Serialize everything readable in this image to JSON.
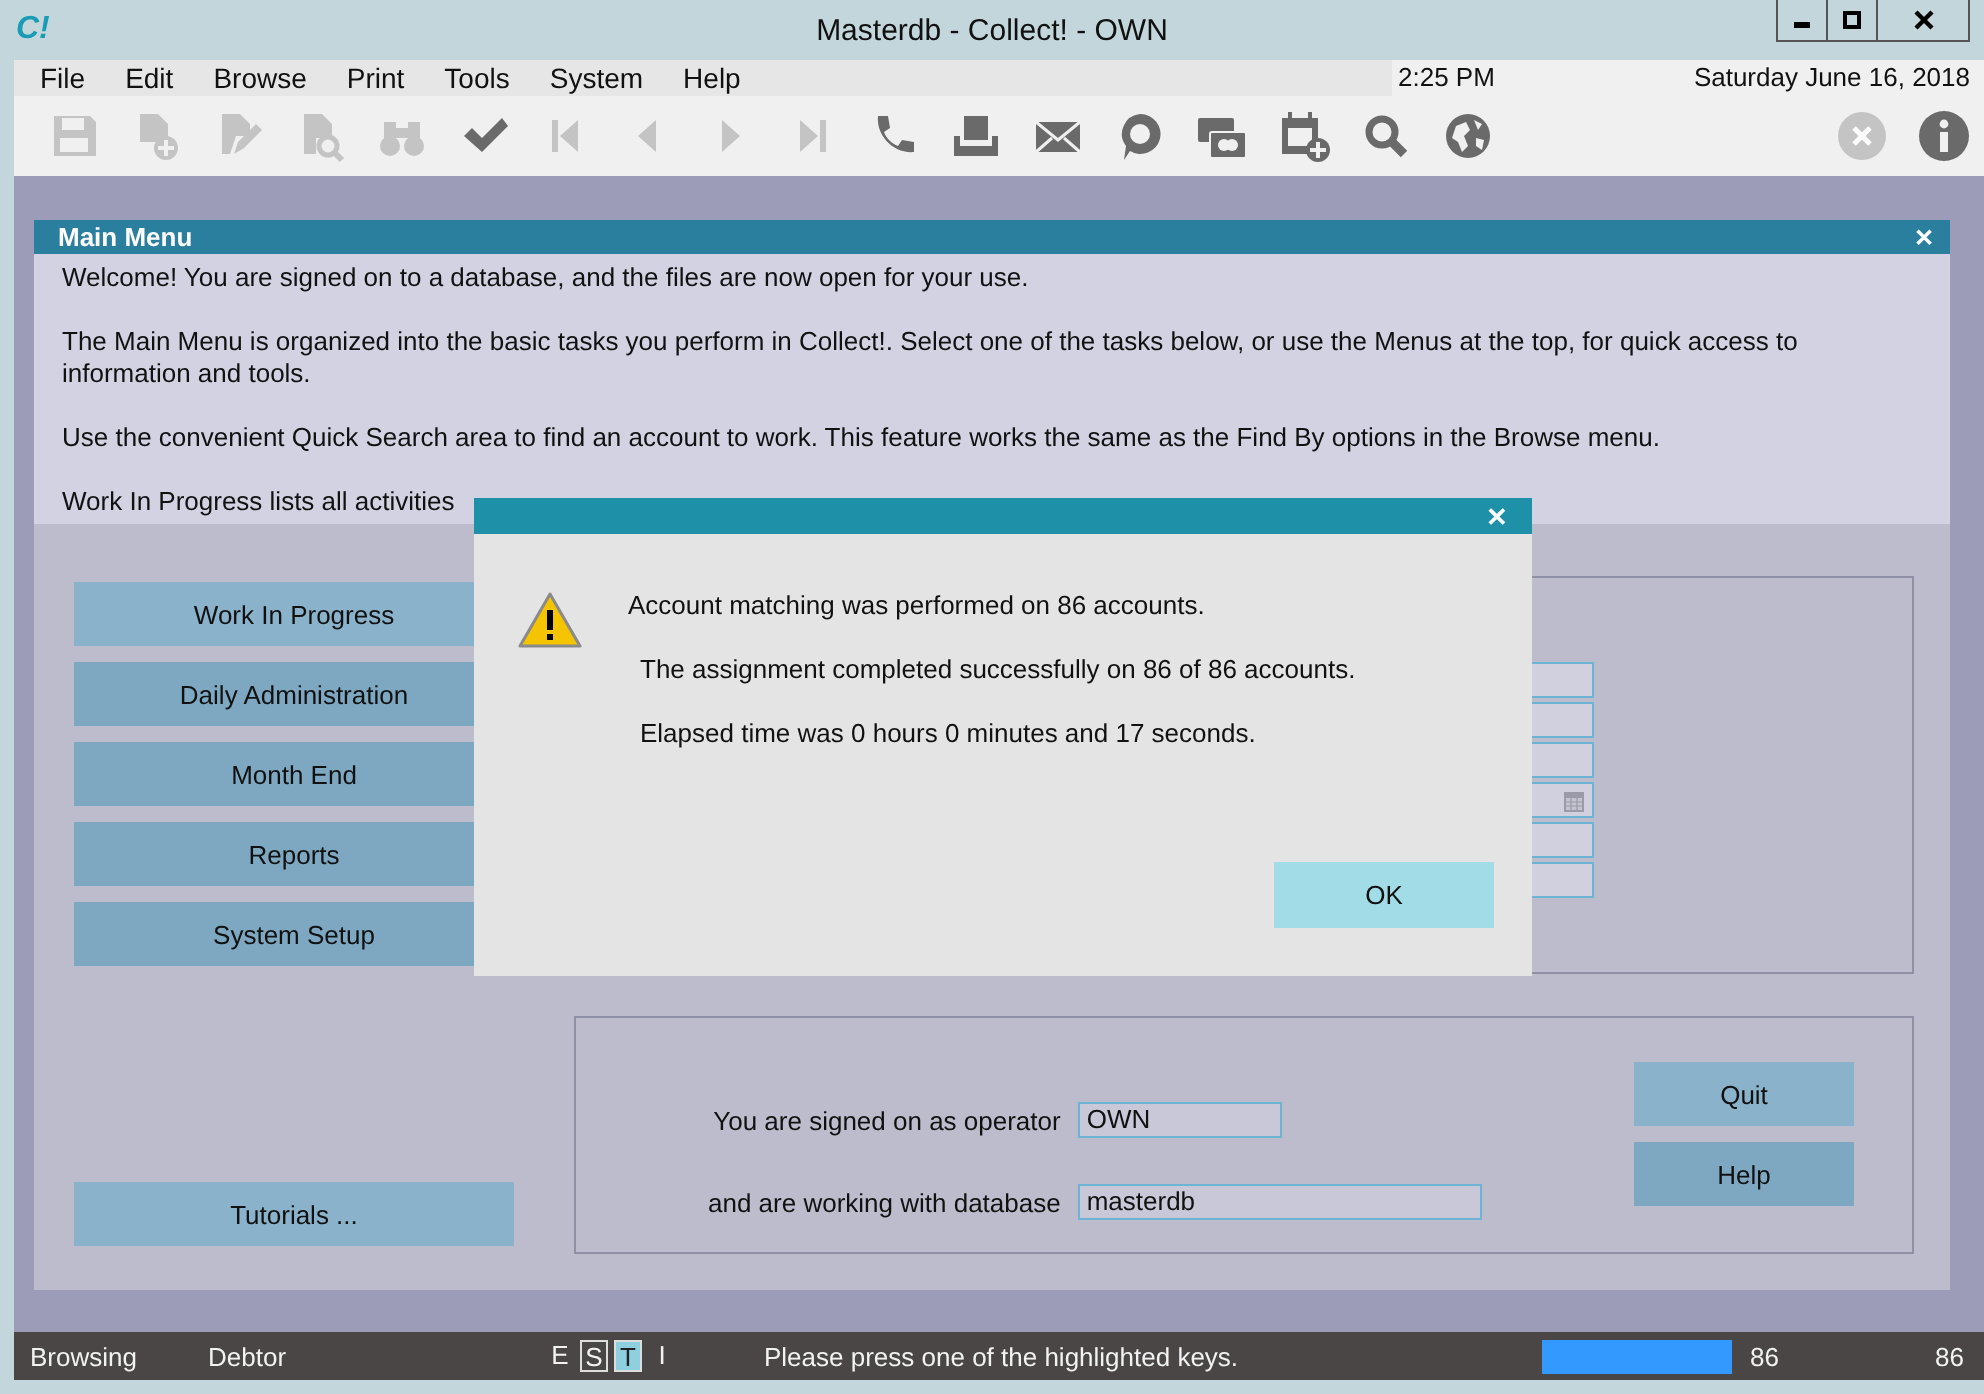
{
  "window": {
    "title": "Masterdb - Collect! - OWN",
    "logo": "C!"
  },
  "menubar": {
    "items": [
      "File",
      "Edit",
      "Browse",
      "Print",
      "Tools",
      "System",
      "Help"
    ],
    "time": "2:25 PM",
    "date": "Saturday  June 16, 2018"
  },
  "toolbar": [
    {
      "kind": "save",
      "disabled": true
    },
    {
      "kind": "new",
      "disabled": true
    },
    {
      "kind": "edit",
      "disabled": true
    },
    {
      "kind": "preview",
      "disabled": true
    },
    {
      "kind": "binoculars",
      "disabled": true
    },
    {
      "kind": "check",
      "disabled": false
    },
    {
      "kind": "first",
      "disabled": true
    },
    {
      "kind": "prev",
      "disabled": true
    },
    {
      "kind": "next",
      "disabled": true
    },
    {
      "kind": "last",
      "disabled": true
    },
    {
      "kind": "phone",
      "disabled": false
    },
    {
      "kind": "print",
      "disabled": false
    },
    {
      "kind": "mail",
      "disabled": false
    },
    {
      "kind": "chat",
      "disabled": false
    },
    {
      "kind": "card",
      "disabled": false
    },
    {
      "kind": "calendar",
      "disabled": false
    },
    {
      "kind": "search",
      "disabled": false
    },
    {
      "kind": "globe",
      "disabled": false
    },
    {
      "kind": "cancel",
      "disabled": true
    },
    {
      "kind": "info",
      "disabled": false
    }
  ],
  "main_menu": {
    "title": "Main Menu",
    "close": "✕",
    "paragraphs": [
      "Welcome! You are signed on to a database, and the files are now open for your use.",
      "The Main Menu is organized into the basic tasks you perform in Collect!. Select one of the tasks below, or use the Menus at the top, for quick access to information and tools.",
      "Use the convenient Quick Search area to find an account to work. This feature works the same as the Find By options in the Browse menu.",
      "Work In Progress lists all activities"
    ],
    "tasks": [
      "Work In Progress",
      "Daily Administration",
      "Month End",
      "Reports",
      "System Setup"
    ],
    "tutorials": "Tutorials ...",
    "operator_label": "You are signed on as operator",
    "operator": "OWN",
    "database_label": "and are working with database",
    "database": "masterdb",
    "buttons": [
      "Quit",
      "Help"
    ]
  },
  "dialog": {
    "close": "✕",
    "messages": [
      "Account matching was performed on 86 accounts.",
      "The assignment completed successfully on 86 of 86 accounts.",
      "Elapsed time was 0 hours 0 minutes and 17 seconds."
    ],
    "button": "OK"
  },
  "status_bar": {
    "mode": "Browsing",
    "form": "Debtor",
    "keys": [
      {
        "label": "E",
        "kind": "plain"
      },
      {
        "label": "S",
        "kind": "boxed"
      },
      {
        "label": "T",
        "kind": "active"
      },
      {
        "label": "I",
        "kind": "plain"
      }
    ],
    "message": "Please press one of the highlighted keys.",
    "count": "86",
    "total": "86"
  }
}
